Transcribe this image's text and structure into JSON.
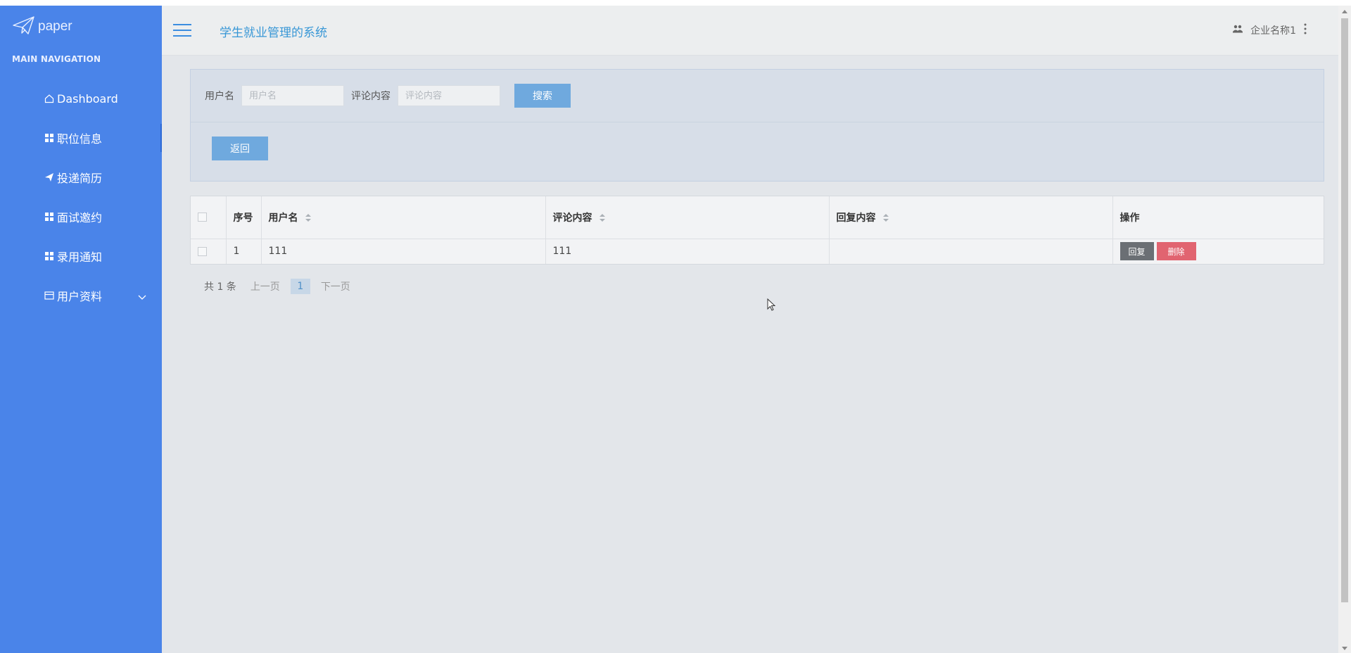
{
  "app": {
    "logo_text": "paper",
    "title": "学生就业管理的系统"
  },
  "sidebar": {
    "heading": "MAIN NAVIGATION",
    "items": [
      {
        "label": "Dashboard",
        "icon": "home-icon"
      },
      {
        "label": "职位信息",
        "icon": "grid-icon"
      },
      {
        "label": "投递简历",
        "icon": "send-icon"
      },
      {
        "label": "面试邀约",
        "icon": "grid-icon"
      },
      {
        "label": "录用通知",
        "icon": "grid-icon"
      },
      {
        "label": "用户资料",
        "icon": "card-icon"
      }
    ]
  },
  "header": {
    "user_name": "企业名称1"
  },
  "search": {
    "username_label": "用户名",
    "username_placeholder": "用户名",
    "comment_label": "评论内容",
    "comment_placeholder": "评论内容",
    "search_button": "搜索",
    "back_button": "返回"
  },
  "table": {
    "columns": [
      "序号",
      "用户名",
      "评论内容",
      "回复内容",
      "操作"
    ],
    "rows": [
      {
        "index": "1",
        "username": "111",
        "comment": "111",
        "reply": ""
      }
    ],
    "reply_button": "回复",
    "delete_button": "删除"
  },
  "pagination": {
    "total": "共 1 条",
    "prev": "上一页",
    "current": "1",
    "next": "下一页"
  },
  "colors": {
    "sidebar_bg": "#4a84e9",
    "accent": "#3897d6",
    "button_primary": "#6fa9de",
    "button_danger": "#e16470",
    "button_dark": "#6b6f74"
  }
}
